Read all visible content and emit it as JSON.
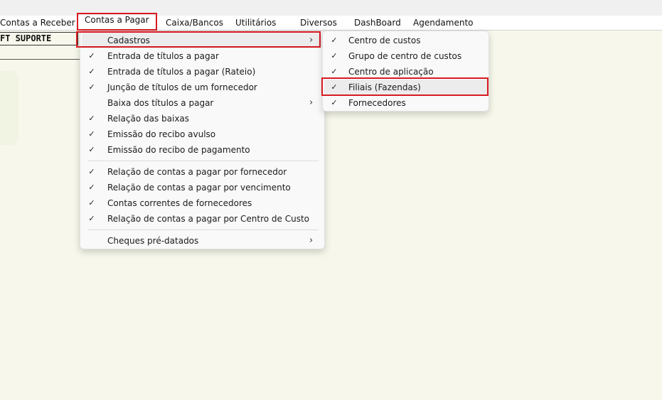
{
  "menubar": {
    "items": [
      {
        "label": "Contas a Receber"
      },
      {
        "label": "Contas a Pagar",
        "active": true
      },
      {
        "label": "Caixa/Bancos"
      },
      {
        "label": "Utilitários"
      },
      {
        "label": "Diversos"
      },
      {
        "label": "DashBoard"
      },
      {
        "label": "Agendamento"
      }
    ]
  },
  "user_label": "FT SUPORTE",
  "contas_menu": {
    "items": [
      {
        "label": "Cadastros",
        "checked": false,
        "submenu": true
      },
      {
        "label": "Entrada de títulos a pagar",
        "checked": true
      },
      {
        "label": "Entrada de títulos a pagar (Rateio)",
        "checked": true
      },
      {
        "label": "Junção de títulos de um fornecedor",
        "checked": true
      },
      {
        "label": "Baixa dos títulos a pagar",
        "checked": false,
        "submenu": true
      },
      {
        "label": "Relação das baixas",
        "checked": true
      },
      {
        "label": "Emissão do recibo avulso",
        "checked": true
      },
      {
        "label": "Emissão do recibo de pagamento",
        "checked": true
      },
      {
        "label": "Relação de contas a pagar por fornecedor",
        "checked": true
      },
      {
        "label": "Relação de contas a pagar por vencimento",
        "checked": true
      },
      {
        "label": "Contas correntes de fornecedores",
        "checked": true
      },
      {
        "label": "Relação de contas a pagar por Centro de Custo",
        "checked": true
      },
      {
        "label": "Cheques pré-datados",
        "checked": false,
        "submenu": true
      }
    ]
  },
  "cadastros_menu": {
    "items": [
      {
        "label": "Centro de custos",
        "checked": true
      },
      {
        "label": "Grupo de centro de custos",
        "checked": true
      },
      {
        "label": "Centro de aplicação",
        "checked": true
      },
      {
        "label": "Filiais (Fazendas)",
        "checked": true
      },
      {
        "label": "Fornecedores",
        "checked": true
      }
    ]
  },
  "icons": {
    "check": "check-icon",
    "submenu_arrow": "chevron-right-icon"
  },
  "colors": {
    "highlight_border": "#d81a22",
    "background": "#f7f8eb",
    "menu_bg": "#f9f9f9"
  }
}
